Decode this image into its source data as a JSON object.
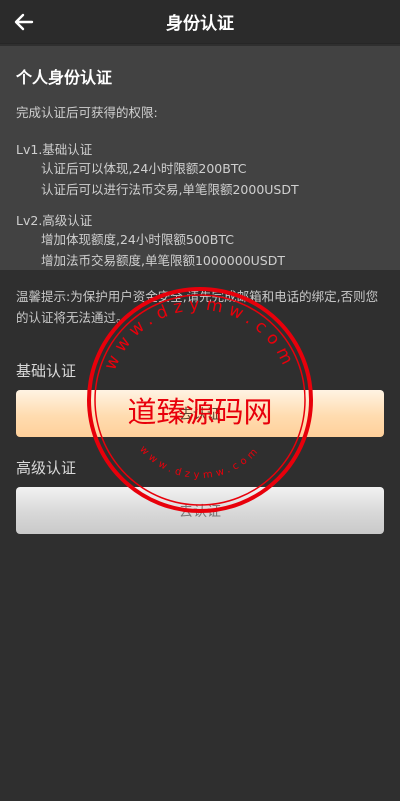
{
  "header": {
    "title": "身份认证",
    "back_icon": "arrow-left-icon"
  },
  "info": {
    "title": "个人身份认证",
    "subtitle": "完成认证后可获得的权限:",
    "levels": [
      {
        "name": "Lv1.基础认证",
        "lines": [
          "认证后可以体现,24小时限额200BTC",
          "认证后可以进行法币交易,单笔限额2000USDT"
        ]
      },
      {
        "name": "Lv2.高级认证",
        "lines": [
          "增加体现额度,24小时限额500BTC",
          "增加法币交易额度,单笔限额1000000USDT"
        ]
      }
    ]
  },
  "tip": "温馨提示:为保护用户资金安全,请先完成邮箱和电话的绑定,否则您的认证将无法通过。",
  "basic": {
    "label": "基础认证",
    "button_label": "去认证"
  },
  "advanced": {
    "label": "高级认证",
    "button_label": "去认证"
  },
  "watermark": {
    "text": "道臻源码网",
    "ring_top": "www.dzymw.com",
    "ring_bottom": "www.dzymw.com",
    "color": "#e8000b"
  }
}
